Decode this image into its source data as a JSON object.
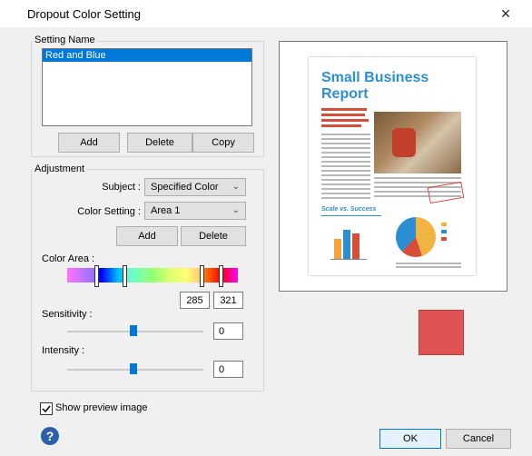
{
  "window": {
    "title": "Dropout Color Setting",
    "close_label": "×"
  },
  "setting_name": {
    "group_label": "Setting Name",
    "items": [
      "Red and Blue"
    ],
    "buttons": {
      "add": "Add",
      "delete": "Delete",
      "copy": "Copy"
    }
  },
  "adjustment": {
    "group_label": "Adjustment",
    "subject_label": "Subject :",
    "subject_value": "Specified Color",
    "color_setting_label": "Color Setting :",
    "color_setting_value": "Area 1",
    "buttons": {
      "add": "Add",
      "delete": "Delete"
    },
    "color_area_label": "Color Area :",
    "color_area_from": "285",
    "color_area_to": "321",
    "sensitivity_label": "Sensitivity :",
    "sensitivity_value": "0",
    "intensity_label": "Intensity :",
    "intensity_value": "0"
  },
  "preview": {
    "headline_line1": "Small Business",
    "headline_line2": "Report",
    "subhead": "Scale vs. Success"
  },
  "footer": {
    "show_preview_label": "Show preview image",
    "show_preview_checked": true,
    "ok": "OK",
    "cancel": "Cancel"
  },
  "colors": {
    "accent": "#0078d7",
    "swatch": "#e15252"
  }
}
